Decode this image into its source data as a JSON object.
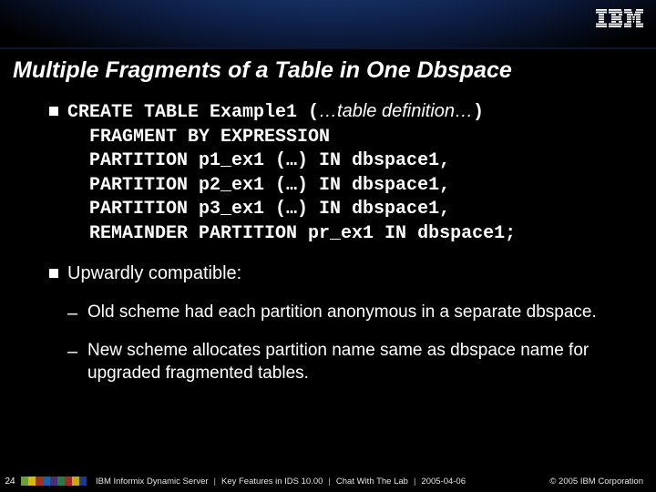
{
  "header": {
    "logo_alt": "IBM"
  },
  "title": "Multiple Fragments of a Table in One Dbspace",
  "code": {
    "prefix1": "CREATE TABLE Example1 (",
    "italic1": "…table definition…",
    "suffix1": ")",
    "line2": "  FRAGMENT BY EXPRESSION",
    "line3": "  PARTITION p1_ex1 (…) IN dbspace1,",
    "line4": "  PARTITION p2_ex1 (…) IN dbspace1,",
    "line5": "  PARTITION p3_ex1 (…) IN dbspace1,",
    "line6": "  REMAINDER PARTITION pr_ex1 IN dbspace1;"
  },
  "bullets": {
    "compat": "Upwardly compatible:",
    "old": "Old scheme had each partition anonymous in a separate dbspace.",
    "new": "New scheme allocates partition name same as dbspace name for upgraded fragmented tables."
  },
  "footer": {
    "page": "24",
    "product": "IBM Informix Dynamic Server",
    "topic": "Key Features in IDS 10.00",
    "event": "Chat With The Lab",
    "date": "2005-04-06",
    "copyright": "© 2005 IBM Corporation"
  }
}
